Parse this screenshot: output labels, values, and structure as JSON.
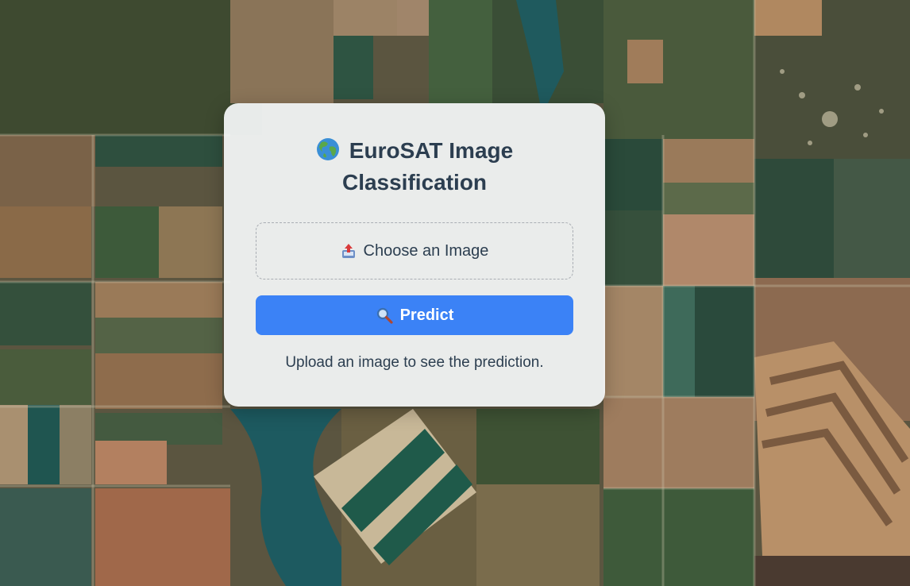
{
  "page": {
    "background": "satellite-farmland-image"
  },
  "card": {
    "title_icon": "globe-icon",
    "title": "EuroSAT Image Classification",
    "upload_icon": "upload-tray-icon",
    "upload_label": "Choose an Image",
    "predict_icon": "magnifier-icon",
    "predict_label": "Predict",
    "result_text": "Upload an image to see the prediction."
  },
  "colors": {
    "title_text": "#2c3e50",
    "button_bg": "#3b82f6",
    "button_text": "#ffffff",
    "card_bg": "#f5f7f9"
  }
}
